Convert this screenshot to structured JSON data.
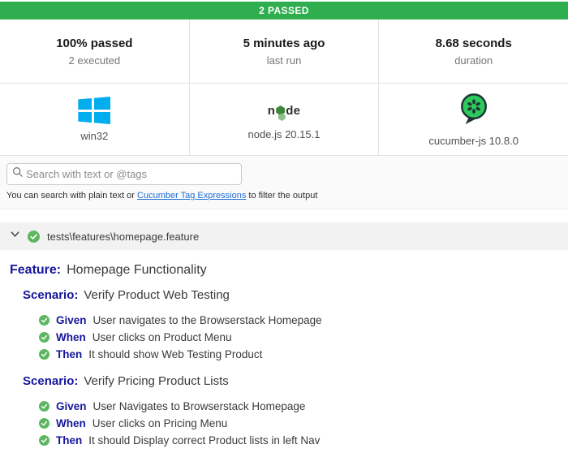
{
  "summary": {
    "label": "2 PASSED"
  },
  "stats": [
    {
      "value": "100% passed",
      "label": "2 executed"
    },
    {
      "value": "5 minutes ago",
      "label": "last run"
    },
    {
      "value": "8.68 seconds",
      "label": "duration"
    }
  ],
  "environment": [
    {
      "icon": "windows-icon",
      "label": "win32"
    },
    {
      "icon": "nodejs-icon",
      "label": "node.js 20.15.1"
    },
    {
      "icon": "cucumber-icon",
      "label": "cucumber-js 10.8.0"
    }
  ],
  "node_logo": {
    "left": "n",
    "right": "de"
  },
  "search": {
    "placeholder": "Search with text or @tags",
    "help_prefix": "You can search with plain text or ",
    "help_link": "Cucumber Tag Expressions",
    "help_suffix": " to filter the output"
  },
  "feature_file": {
    "path": "tests\\features\\homepage.feature",
    "status": "passed"
  },
  "feature": {
    "keyword": "Feature:",
    "name": "Homepage Functionality",
    "scenarios": [
      {
        "keyword": "Scenario:",
        "name": "Verify Product Web Testing",
        "steps": [
          {
            "keyword": "Given",
            "text": "User navigates to the Browserstack Homepage",
            "status": "passed"
          },
          {
            "keyword": "When",
            "text": "User clicks on Product Menu",
            "status": "passed"
          },
          {
            "keyword": "Then",
            "text": "It should show Web Testing Product",
            "status": "passed"
          }
        ]
      },
      {
        "keyword": "Scenario:",
        "name": "Verify Pricing Product Lists",
        "steps": [
          {
            "keyword": "Given",
            "text": "User Navigates to Browserstack Homepage",
            "status": "passed"
          },
          {
            "keyword": "When",
            "text": "User clicks on Pricing Menu",
            "status": "passed"
          },
          {
            "keyword": "Then",
            "text": "It should Display correct Product lists in left Nav",
            "status": "passed"
          }
        ]
      }
    ]
  },
  "colors": {
    "passed-green": "#2eae4f",
    "check-green": "#5cb860",
    "keyword-navy": "#16169c",
    "windows-blue": "#00adef",
    "node-green": "#3c873a",
    "cucumber-green": "#2dc95c",
    "cucumber-dark": "#1d3632",
    "link-blue": "#1d6fd8",
    "text-dark": "#3a3a3a",
    "text-muted": "#757575",
    "border-gray": "#e3e3e3"
  }
}
